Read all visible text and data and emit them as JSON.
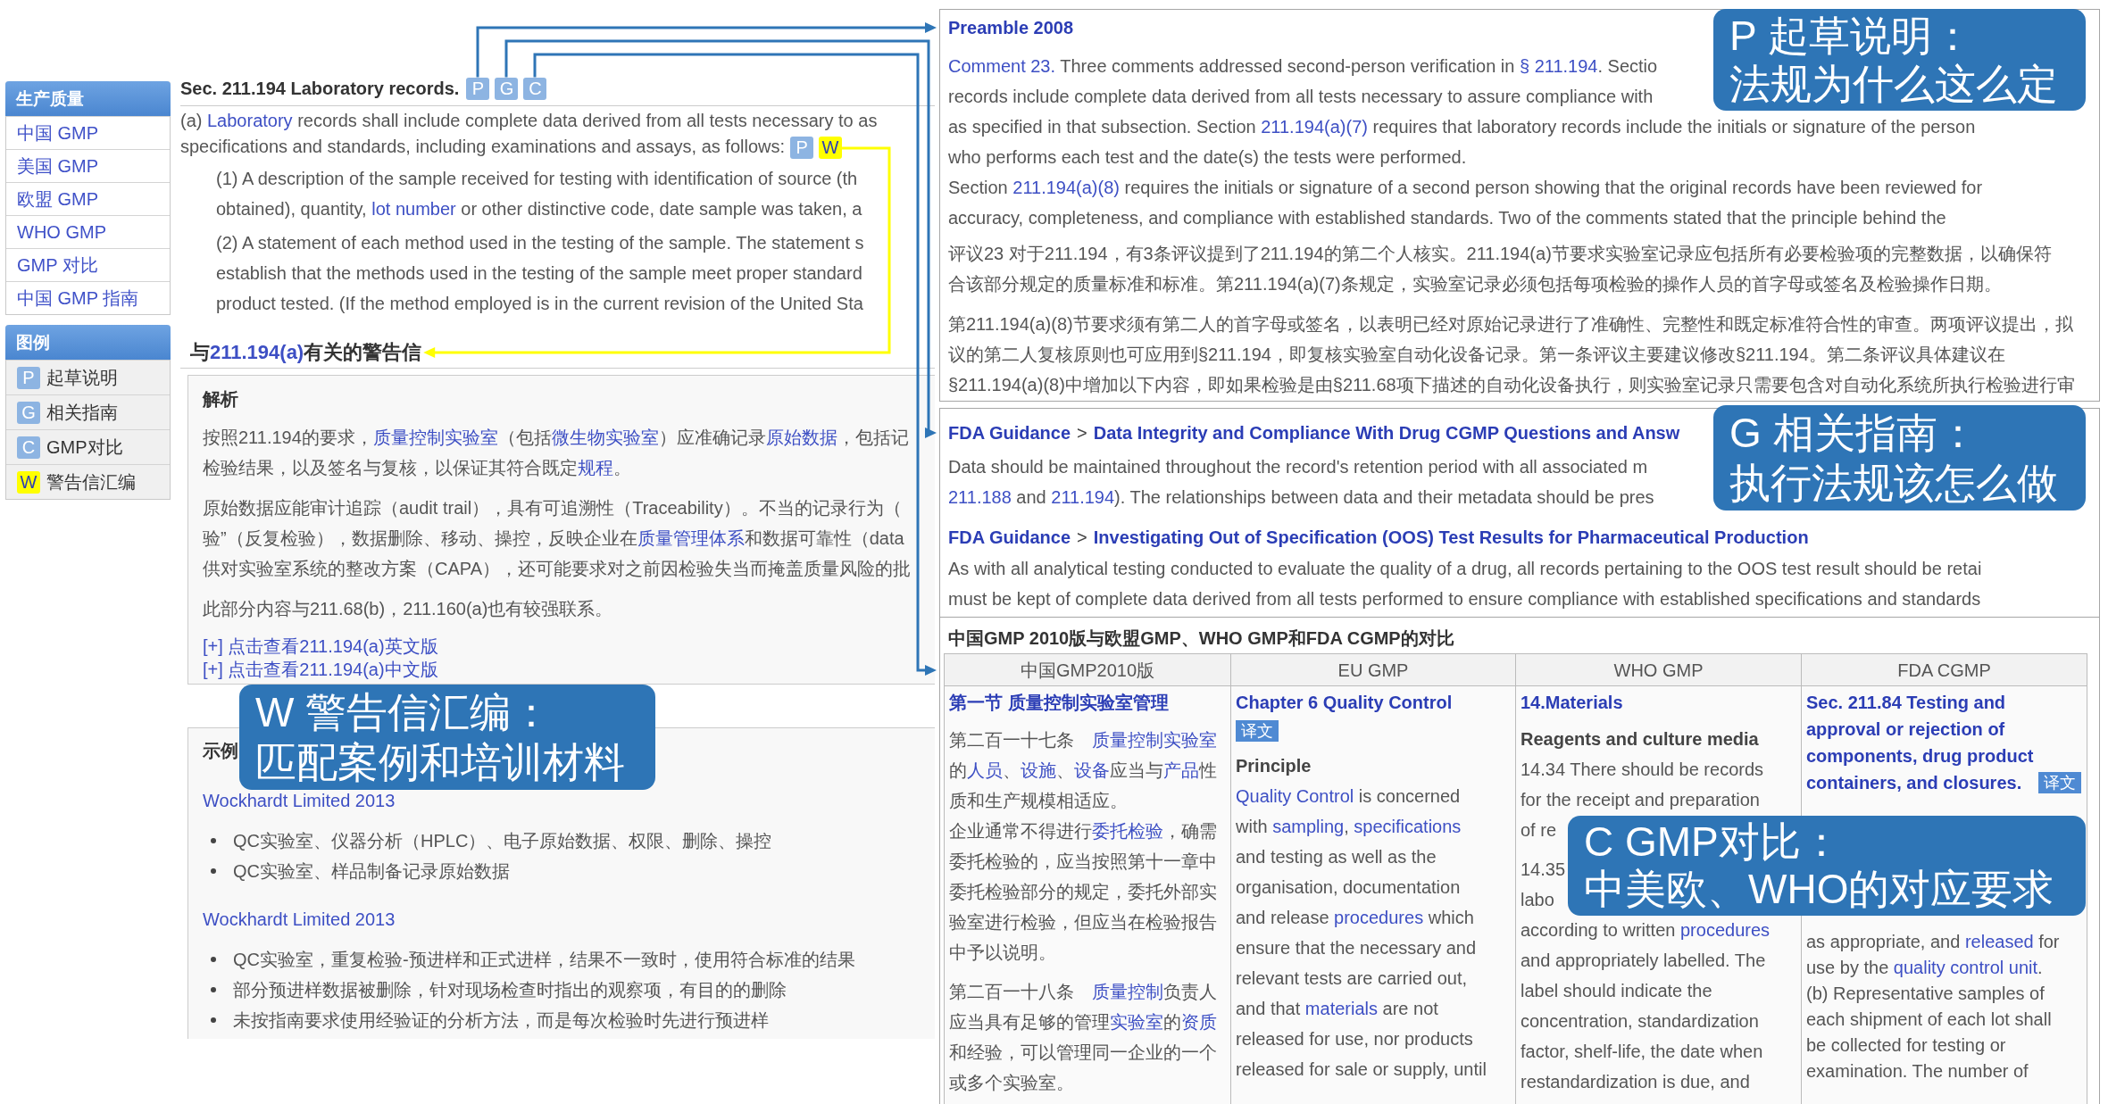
{
  "sidebar": {
    "groups": [
      {
        "kind": "nav",
        "title": "生产质量",
        "items": [
          {
            "label": "中国 GMP"
          },
          {
            "label": "美国 GMP"
          },
          {
            "label": "欧盟 GMP"
          },
          {
            "label": "WHO GMP"
          },
          {
            "label": "GMP 对比"
          },
          {
            "label": "中国 GMP 指南"
          }
        ]
      },
      {
        "kind": "legend",
        "title": "图例",
        "items": [
          {
            "letter": "P",
            "label": "起草说明",
            "color": "#8db4e2"
          },
          {
            "letter": "G",
            "label": "相关指南",
            "color": "#8db4e2"
          },
          {
            "letter": "C",
            "label": "GMP对比",
            "color": "#8db4e2"
          },
          {
            "letter": "W",
            "label": "警告信汇编",
            "color": "#ffff00"
          }
        ]
      }
    ]
  },
  "article": {
    "title": "Sec. 211.194 Laboratory records.",
    "title_badges": [
      {
        "letter": "P",
        "color": "#8db4e2",
        "connected": true
      },
      {
        "letter": "G",
        "color": "#8db4e2",
        "connected": true
      },
      {
        "letter": "C",
        "color": "#8db4e2",
        "connected": true
      }
    ],
    "clauses": [
      {
        "kind": "clause",
        "parts": [
          [
            [
              {
                "kind": "text",
                "text": "(a) "
              },
              {
                "kind": "link",
                "text": "Laboratory"
              },
              {
                "kind": "text",
                "text": " records shall include complete data derived from all tests necessary to as"
              }
            ]
          ],
          [
            [
              {
                "kind": "text",
                "text": "specifications and standards, including examinations and assays, as follows:"
              }
            ]
          ]
        ],
        "badges": [
          {
            "letter": "P",
            "color": "#8db4e2",
            "connected": false
          },
          {
            "letter": "W",
            "color": "#ffff00",
            "connected": true
          }
        ]
      },
      {
        "kind": "subclause",
        "parts": [
          [
            [
              {
                "kind": "text",
                "text": "(1) A description of the sample received for testing with identification of source (th"
              }
            ]
          ],
          [
            [
              {
                "kind": "text",
                "text": "obtained), quantity, "
              },
              {
                "kind": "link",
                "text": "lot number"
              },
              {
                "kind": "text",
                "text": " or other distinctive code, date sample was taken, a"
              }
            ]
          ]
        ]
      },
      {
        "kind": "subclause",
        "parts": [
          [
            [
              {
                "kind": "text",
                "text": "(2) A statement of each method used in the testing of the sample. The statement s"
              }
            ]
          ],
          [
            [
              {
                "kind": "text",
                "text": "establish that the methods used in the testing of the sample meet proper standard"
              }
            ]
          ],
          [
            [
              {
                "kind": "text",
                "text": "product tested. (If the method employed is in the current revision of the United Sta"
              }
            ]
          ]
        ]
      }
    ],
    "warning_heading": [
      {
        "kind": "text",
        "text": "与"
      },
      {
        "kind": "link",
        "text": "211.194(a)"
      },
      {
        "kind": "text",
        "text": "有关的警告信"
      }
    ],
    "analysis": {
      "title": "解析",
      "paragraphs": [
        {
          "parts": [
            [
              [
                {
                  "kind": "text",
                  "text": "按照211.194的要求，"
                },
                {
                  "kind": "link",
                  "text": "质量控制实验室"
                },
                {
                  "kind": "text",
                  "text": "（包括"
                },
                {
                  "kind": "link",
                  "text": "微生物实验室"
                },
                {
                  "kind": "text",
                  "text": "）应准确记录"
                },
                {
                  "kind": "link",
                  "text": "原始数据"
                },
                {
                  "kind": "text",
                  "text": "，包括记"
                }
              ]
            ],
            [
              [
                {
                  "kind": "text",
                  "text": "检验结果，以及签名与复核，以保证其符合既定"
                },
                {
                  "kind": "link",
                  "text": "规程"
                },
                {
                  "kind": "text",
                  "text": "。"
                }
              ]
            ]
          ]
        },
        {
          "parts": [
            [
              [
                {
                  "kind": "text",
                  "text": "原始数据应能审计追踪（audit trail），具有可追溯性（Traceability）。不当的记录行为（"
                }
              ]
            ],
            [
              [
                {
                  "kind": "text",
                  "text": "验”（反复检验），数据删除、移动、操控，反映企业在"
                },
                {
                  "kind": "link",
                  "text": "质量管理体系"
                },
                {
                  "kind": "text",
                  "text": "和数据可靠性（data"
                }
              ]
            ],
            [
              [
                {
                  "kind": "text",
                  "text": "供对实验室系统的整改方案（CAPA），还可能要求对之前因检验失当而掩盖质量风险的批"
                }
              ]
            ]
          ]
        },
        {
          "parts": [
            [
              [
                {
                  "kind": "text",
                  "text": "此部分内容与211.68(b)，211.160(a)也有较强联系。"
                }
              ]
            ]
          ]
        }
      ],
      "expand_links": [
        "[+] 点击查看211.194(a)英文版",
        "[+] 点击查看211.194(a)中文版"
      ]
    },
    "callout": {
      "lines": [
        "W 警告信汇编：",
        "匹配案例和培训材料"
      ]
    },
    "examples": {
      "title": "示例",
      "groups": [
        {
          "company": "Wockhardt Limited 2013",
          "findings": [
            "QC实验室、仪器分析（HPLC）、电子原始数据、权限、删除、操控",
            "QC实验室、样品制备记录原始数据"
          ]
        },
        {
          "company": "Wockhardt Limited 2013",
          "findings": [
            "QC实验室，重复检验-预进样和正式进样，结果不一致时，使用符合标准的结果",
            "部分预进样数据被删除，针对现场检查时指出的观察项，有目的的删除",
            "未按指南要求使用经验证的分析方法，而是每次检验时先进行预进样"
          ]
        }
      ]
    }
  },
  "panel": {
    "preamble": {
      "title": "Preamble 2008",
      "paragraphs": [
        {
          "parts": [
            [
              [
                {
                  "kind": "link",
                  "text": "Comment 23."
                },
                {
                  "kind": "text",
                  "text": " Three comments addressed second-person verification in "
                },
                {
                  "kind": "link",
                  "text": "§ 211.194"
                },
                {
                  "kind": "text",
                  "text": ". Sectio"
                }
              ]
            ],
            [
              [
                {
                  "kind": "text",
                  "text": "records include complete data derived from all tests necessary to assure compliance with"
                }
              ]
            ],
            [
              [
                {
                  "kind": "text",
                  "text": "as specified in that subsection. Section "
                },
                {
                  "kind": "link",
                  "text": "211.194(a)(7)"
                },
                {
                  "kind": "text",
                  "text": " requires that laboratory records include the initials or signature of the person"
                }
              ],
              [
                {
                  "kind": "text",
                  "text": "who performs each test and the date(s) the tests were performed."
                }
              ],
              [
                {
                  "kind": "text",
                  "text": "Section "
                },
                {
                  "kind": "link",
                  "text": "211.194(a)(8)"
                },
                {
                  "kind": "text",
                  "text": " requires the initials or signature of a second person showing that the original records have been reviewed for"
                }
              ],
              [
                {
                  "kind": "text",
                  "text": "accuracy, completeness, and compliance with established standards. Two of the comments stated that the principle behind the"
                }
              ]
            ]
          ]
        },
        {
          "parts": [
            [
              [
                {
                  "kind": "text",
                  "text": "评议23 对于211.194，有3条评议提到了211.194的第二个人核实。211.194(a)节要求实验室记录应包括所有必要检验项的完整数据，以确保符"
                }
              ],
              [
                {
                  "kind": "text",
                  "text": "合该部分规定的质量标准和标准。第211.194(a)(7)条规定，实验室记录必须包括每项检验的操作人员的首字母或签名及检验操作日期。"
                }
              ]
            ]
          ]
        },
        {
          "parts": [
            [
              [
                {
                  "kind": "text",
                  "text": "第211.194(a)(8)节要求须有第二人的首字母或签名，以表明已经对原始记录进行了准确性、完整性和既定标准符合性的审查。两项评议提出，拟"
                }
              ],
              [
                {
                  "kind": "text",
                  "text": "议的第二人复核原则也可应用到§211.194，即复核实验室自动化设备记录。第一条评议主要建议修改§211.194。第二条评议具体建议在"
                }
              ],
              [
                {
                  "kind": "text",
                  "text": "§211.194(a)(8)中增加以下内容，即如果检验是由§211.68项下描述的自动化设备执行，则实验室记录只需要包含对自动化系统所执行检验进行审"
                }
              ]
            ]
          ]
        }
      ],
      "callout": {
        "lines": [
          "P 起草说明：",
          "法规为什么这么定"
        ]
      }
    },
    "guidance": {
      "entries": [
        {
          "source": "FDA Guidance",
          "separator": ">",
          "title": "Data Integrity and Compliance With Drug CGMP Questions and Answ",
          "parts": [
            [
              [
                {
                  "kind": "text",
                  "text": "Data should be maintained throughout the record's retention period with all associated m"
                }
              ]
            ],
            [
              [
                {
                  "kind": "link",
                  "text": "211.188"
                },
                {
                  "kind": "text",
                  "text": " and "
                },
                {
                  "kind": "link",
                  "text": "211.194"
                },
                {
                  "kind": "text",
                  "text": "). The relationships between data and their metadata should be pres"
                }
              ]
            ]
          ]
        },
        {
          "source": "FDA Guidance",
          "separator": ">",
          "title": "Investigating Out of Specification (OOS) Test Results for Pharmaceutical Production",
          "parts": [
            [
              [
                {
                  "kind": "text",
                  "text": "As with all analytical testing conducted to evaluate the quality of a drug, all records pertaining to the OOS test result should be retai"
                }
              ]
            ],
            [
              [
                {
                  "kind": "text",
                  "text": "must be kept of complete data derived from all tests performed to ensure compliance with established specifications and standards"
                }
              ]
            ]
          ]
        }
      ],
      "callout": {
        "lines": [
          "G 相关指南：",
          "执行法规该怎么做"
        ]
      }
    },
    "comparison": {
      "title": "中国GMP 2010版与欧盟GMP、WHO GMP和FDA CGMP的对比",
      "columns": [
        "中国GMP2010版",
        "EU GMP",
        "WHO GMP",
        "FDA CGMP"
      ],
      "cells": [
        [
          {
            "kind": "heading",
            "lines": [
              "第一节 质量控制实验室管理"
            ]
          },
          {
            "kind": "text",
            "parts": [
              [
                [
                  {
                    "kind": "text",
                    "text": "第二百一十七条　"
                  },
                  {
                    "kind": "link",
                    "text": "质量控制实验室"
                  }
                ],
                [
                  {
                    "kind": "text",
                    "text": "的"
                  },
                  {
                    "kind": "link",
                    "text": "人员"
                  },
                  {
                    "kind": "text",
                    "text": "、"
                  },
                  {
                    "kind": "link",
                    "text": "设施"
                  },
                  {
                    "kind": "text",
                    "text": "、"
                  },
                  {
                    "kind": "link",
                    "text": "设备"
                  },
                  {
                    "kind": "text",
                    "text": "应当与"
                  },
                  {
                    "kind": "link",
                    "text": "产品"
                  },
                  {
                    "kind": "text",
                    "text": "性"
                  }
                ],
                [
                  {
                    "kind": "text",
                    "text": "质和生产规模相适应。"
                  }
                ],
                [
                  {
                    "kind": "text",
                    "text": "企业通常不得进行"
                  },
                  {
                    "kind": "link",
                    "text": "委托检验"
                  },
                  {
                    "kind": "text",
                    "text": "，确需"
                  }
                ],
                [
                  {
                    "kind": "text",
                    "text": "委托检验的，应当按照第十一章中"
                  }
                ],
                [
                  {
                    "kind": "text",
                    "text": "委托检验部分的规定，委托外部实"
                  }
                ],
                [
                  {
                    "kind": "text",
                    "text": "验室进行检验，但应当在检验报告"
                  }
                ],
                [
                  {
                    "kind": "text",
                    "text": "中予以说明。"
                  }
                ]
              ]
            ]
          },
          {
            "kind": "text",
            "parts": [
              [
                [
                  {
                    "kind": "text",
                    "text": "第二百一十八条　"
                  },
                  {
                    "kind": "link",
                    "text": "质量控制"
                  },
                  {
                    "kind": "text",
                    "text": "负责人"
                  }
                ],
                [
                  {
                    "kind": "text",
                    "text": "应当具有足够的管理"
                  },
                  {
                    "kind": "link",
                    "text": "实验室"
                  },
                  {
                    "kind": "text",
                    "text": "的"
                  },
                  {
                    "kind": "link",
                    "text": "资质"
                  }
                ],
                [
                  {
                    "kind": "text",
                    "text": "和经验，可以管理同一企业的一个"
                  }
                ],
                [
                  {
                    "kind": "text",
                    "text": "或多个实验室。"
                  }
                ]
              ]
            ]
          }
        ],
        [
          {
            "kind": "heading",
            "lines": [
              "Chapter 6 Quality Control"
            ]
          },
          {
            "kind": "tag",
            "text": "译文"
          },
          {
            "kind": "label",
            "text": "Principle"
          },
          {
            "kind": "text",
            "parts": [
              [
                [
                  {
                    "kind": "link",
                    "text": "Quality Control"
                  },
                  {
                    "kind": "text",
                    "text": " is concerned"
                  }
                ],
                [
                  {
                    "kind": "text",
                    "text": "with "
                  },
                  {
                    "kind": "link",
                    "text": "sampling"
                  },
                  {
                    "kind": "text",
                    "text": ", "
                  },
                  {
                    "kind": "link",
                    "text": "specifications"
                  }
                ],
                [
                  {
                    "kind": "text",
                    "text": "and testing as well as the"
                  }
                ],
                [
                  {
                    "kind": "text",
                    "text": "organisation, documentation"
                  }
                ],
                [
                  {
                    "kind": "text",
                    "text": "and release "
                  },
                  {
                    "kind": "link",
                    "text": "procedures"
                  },
                  {
                    "kind": "text",
                    "text": " which"
                  }
                ],
                [
                  {
                    "kind": "text",
                    "text": "ensure that the necessary and"
                  }
                ],
                [
                  {
                    "kind": "text",
                    "text": "relevant tests are carried out,"
                  }
                ],
                [
                  {
                    "kind": "text",
                    "text": "and that "
                  },
                  {
                    "kind": "link",
                    "text": "materials"
                  },
                  {
                    "kind": "text",
                    "text": " are not"
                  }
                ],
                [
                  {
                    "kind": "text",
                    "text": "released for use, nor products"
                  }
                ],
                [
                  {
                    "kind": "text",
                    "text": "released for sale or supply, until"
                  }
                ]
              ]
            ]
          }
        ],
        [
          {
            "kind": "heading",
            "lines": [
              "14.Materials"
            ]
          },
          {
            "kind": "label",
            "text": "Reagents and culture media"
          },
          {
            "kind": "text",
            "parts": [
              [
                [
                  {
                    "kind": "text",
                    "text": "14.34 There should be records"
                  }
                ],
                [
                  {
                    "kind": "text",
                    "text": "for the receipt and preparation"
                  }
                ]
              ],
              [
                [
                  {
                    "kind": "text",
                    "text": "of re"
                  }
                ]
              ]
            ]
          },
          {
            "kind": "text",
            "parts": [
              [
                [
                  {
                    "kind": "text",
                    "text": "14.35"
                  }
                ]
              ],
              [
                [
                  {
                    "kind": "text",
                    "text": "labo"
                  }
                ]
              ],
              [
                [
                  {
                    "kind": "text",
                    "text": "according to written "
                  },
                  {
                    "kind": "link",
                    "text": "procedures"
                  }
                ],
                [
                  {
                    "kind": "text",
                    "text": "and appropriately labelled. The"
                  }
                ],
                [
                  {
                    "kind": "text",
                    "text": "label should indicate the"
                  }
                ],
                [
                  {
                    "kind": "text",
                    "text": "concentration, standardization"
                  }
                ],
                [
                  {
                    "kind": "text",
                    "text": "factor, shelf-life, the date when"
                  }
                ],
                [
                  {
                    "kind": "text",
                    "text": "restandardization is due, and"
                  }
                ]
              ]
            ]
          }
        ],
        [
          {
            "kind": "heading",
            "lines": [
              "Sec. 211.84 Testing and",
              "approval or rejection of",
              "components, drug product",
              "containers, and closures."
            ],
            "tag": "译文"
          },
          {
            "kind": "text",
            "parts": [
              [
                [
                  {
                    "kind": "text",
                    "text": "as appropriate, and "
                  },
                  {
                    "kind": "link",
                    "text": "released"
                  },
                  {
                    "kind": "text",
                    "text": " for"
                  }
                ],
                [
                  {
                    "kind": "text",
                    "text": "use by the "
                  },
                  {
                    "kind": "link",
                    "text": "quality control unit"
                  },
                  {
                    "kind": "text",
                    "text": "."
                  }
                ],
                [
                  {
                    "kind": "text",
                    "text": "(b) Representative samples of"
                  }
                ],
                [
                  {
                    "kind": "text",
                    "text": "each shipment of each lot shall"
                  }
                ],
                [
                  {
                    "kind": "text",
                    "text": "be collected for testing or"
                  }
                ],
                [
                  {
                    "kind": "text",
                    "text": "examination. The number of"
                  }
                ]
              ]
            ]
          }
        ]
      ],
      "callout": {
        "lines": [
          "C GMP对比：",
          "中美欧、WHO的对应要求"
        ]
      }
    }
  }
}
